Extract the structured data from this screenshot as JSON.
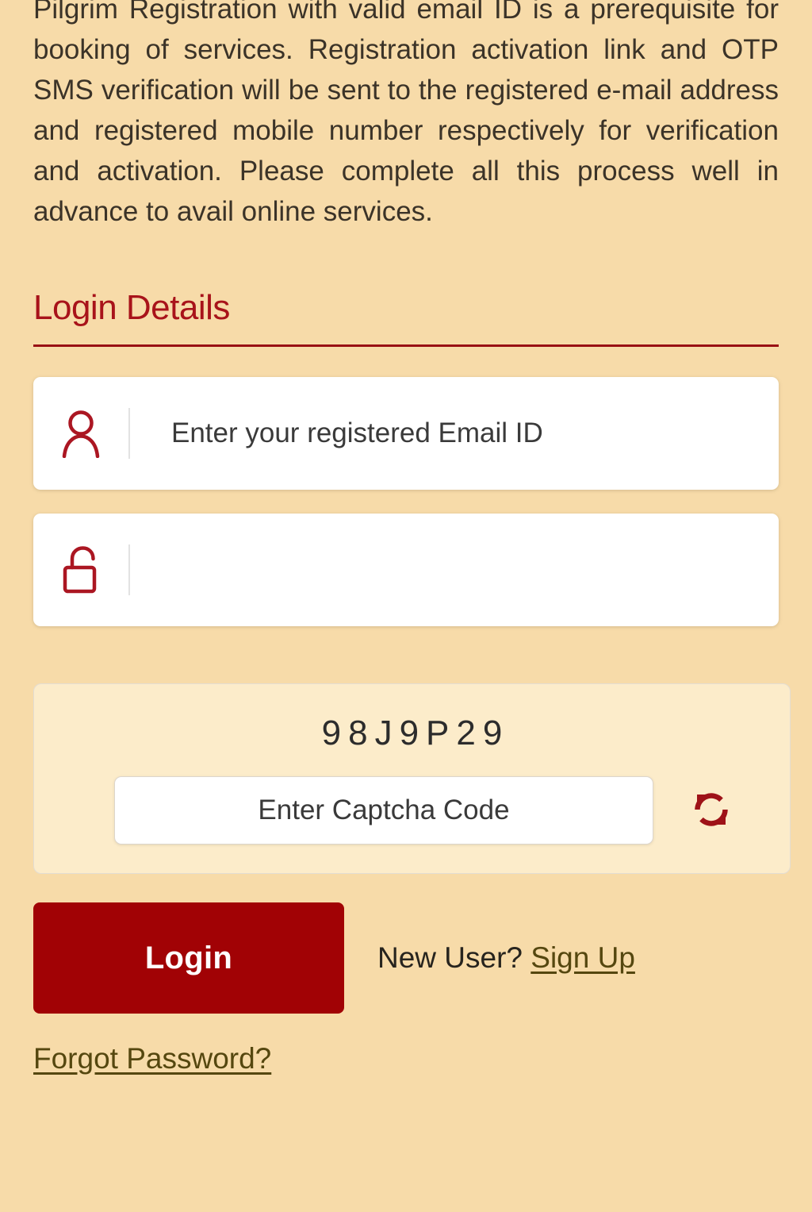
{
  "intro": {
    "paragraph": "Pilgrim Registration with valid email ID is a prerequisite for booking of services. Registration activation link and OTP SMS verification will be sent to the registered e-mail address and registered mobile number respectively for verification and activation. Please complete all this process well in advance to avail online services."
  },
  "login_section": {
    "title": "Login Details",
    "email": {
      "placeholder": "Enter your registered Email ID",
      "value": "",
      "icon": "user-icon"
    },
    "password": {
      "placeholder": "",
      "value": "",
      "icon": "unlock-icon"
    },
    "captcha": {
      "code": "98J9P29",
      "input_placeholder": "Enter Captcha Code",
      "input_value": "",
      "refresh_icon": "refresh-icon"
    },
    "actions": {
      "login_label": "Login",
      "new_user_text": "New User?",
      "sign_up_label": "Sign Up",
      "forgot_password_label": "Forgot Password?"
    }
  },
  "colors": {
    "page_background": "#f7dba9",
    "panel_background": "#fcecca",
    "accent_red": "#a8131a",
    "button_red": "#a10205",
    "icon_red": "#ab1622",
    "link_olive": "#55470f",
    "body_text": "#3b3328"
  }
}
